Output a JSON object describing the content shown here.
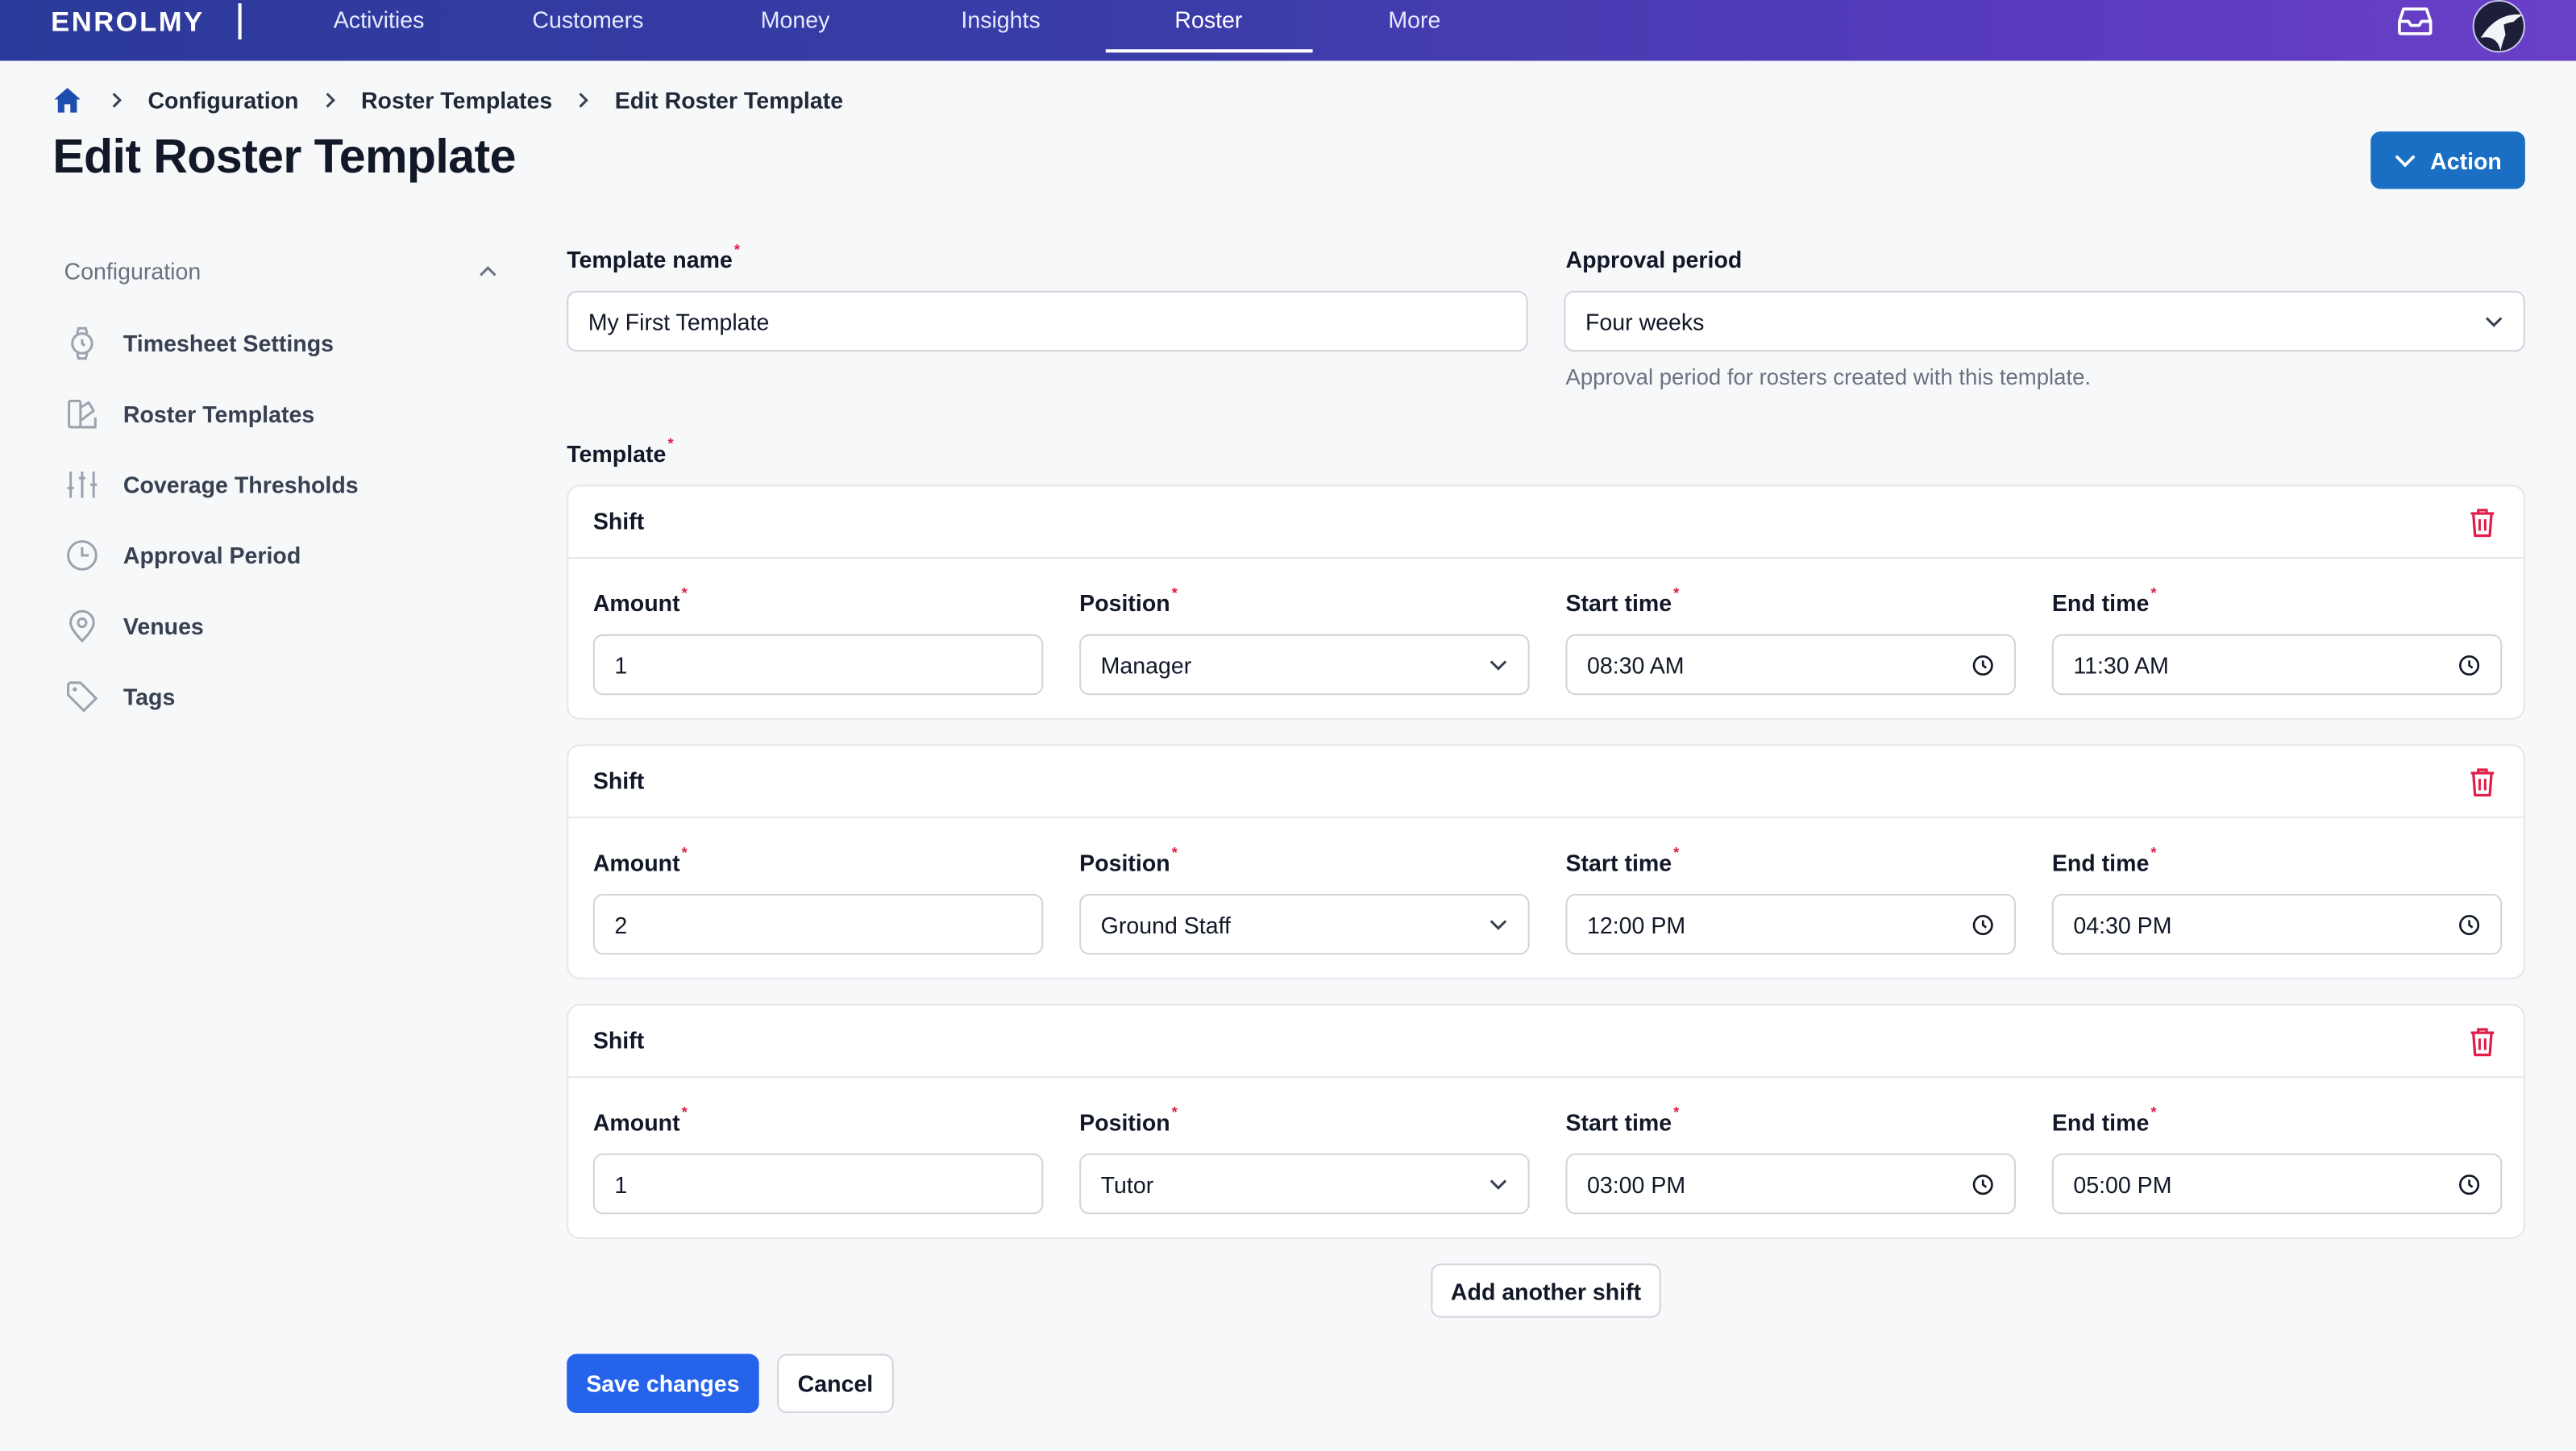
{
  "nav": {
    "logo": "ENROLMY",
    "items": [
      {
        "label": "Activities"
      },
      {
        "label": "Customers"
      },
      {
        "label": "Money"
      },
      {
        "label": "Insights"
      },
      {
        "label": "Roster"
      },
      {
        "label": "More"
      }
    ]
  },
  "breadcrumb": {
    "items": [
      "Configuration",
      "Roster Templates",
      "Edit Roster Template"
    ]
  },
  "page": {
    "title": "Edit Roster Template",
    "action_label": "Action"
  },
  "sidebar": {
    "heading": "Configuration",
    "items": [
      {
        "label": "Timesheet Settings",
        "icon": "watch-icon"
      },
      {
        "label": "Roster Templates",
        "icon": "template-icon"
      },
      {
        "label": "Coverage Thresholds",
        "icon": "sliders-icon"
      },
      {
        "label": "Approval Period",
        "icon": "clock-icon"
      },
      {
        "label": "Venues",
        "icon": "location-pin-icon"
      },
      {
        "label": "Tags",
        "icon": "tag-icon"
      }
    ]
  },
  "form": {
    "template_name_label": "Template name",
    "template_name_value": "My First Template",
    "approval_period_label": "Approval period",
    "approval_period_value": "Four weeks",
    "approval_period_hint": "Approval period for rosters created with this template.",
    "template_label": "Template",
    "shift_title": "Shift",
    "amount_label": "Amount",
    "position_label": "Position",
    "start_label": "Start time",
    "end_label": "End time",
    "shifts": [
      {
        "amount": "1",
        "position": "Manager",
        "start": "08:30 AM",
        "end": "11:30 AM"
      },
      {
        "amount": "2",
        "position": "Ground Staff",
        "start": "12:00 PM",
        "end": "04:30 PM"
      },
      {
        "amount": "1",
        "position": "Tutor",
        "start": "03:00 PM",
        "end": "05:00 PM"
      }
    ],
    "add_shift_label": "Add another shift",
    "save_label": "Save changes",
    "cancel_label": "Cancel"
  },
  "colors": {
    "primary": "#2563eb",
    "action": "#1a6fc4",
    "danger": "#e11d48"
  }
}
